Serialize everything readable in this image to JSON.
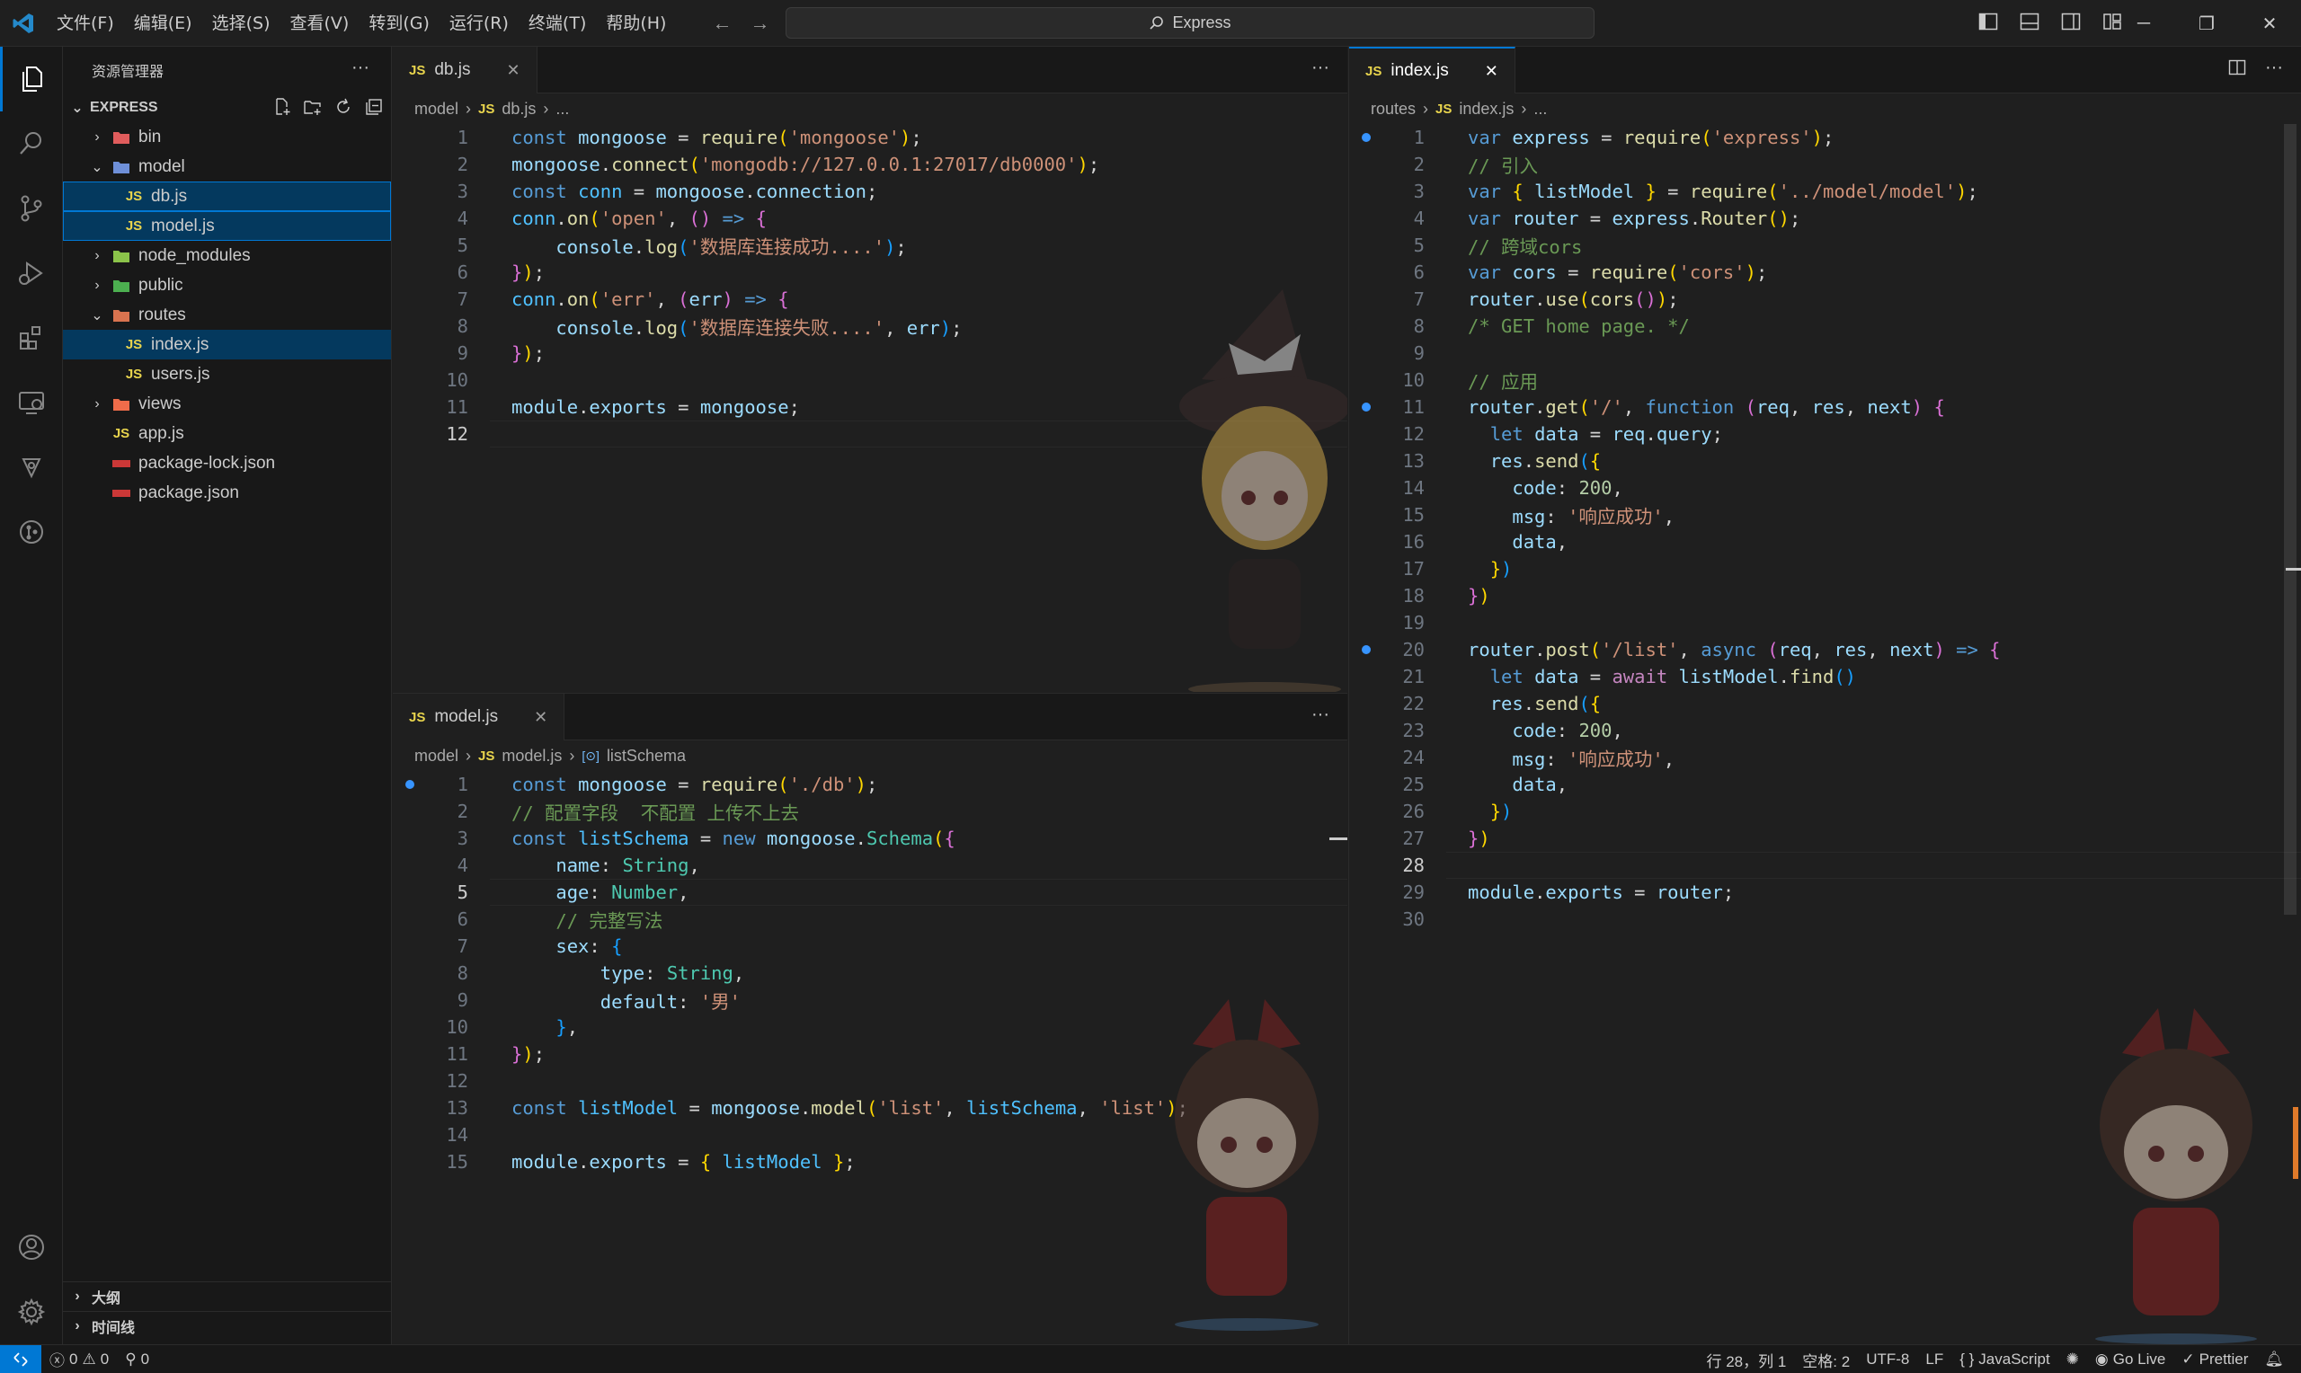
{
  "titlebar": {
    "menu": [
      "文件(F)",
      "编辑(E)",
      "选择(S)",
      "查看(V)",
      "转到(G)",
      "运行(R)",
      "终端(T)",
      "帮助(H)"
    ],
    "search_text": "Express"
  },
  "sidebar": {
    "title": "资源管理器",
    "root": "EXPRESS",
    "tree": [
      {
        "label": "bin"
      },
      {
        "label": "model"
      },
      {
        "label": "db.js"
      },
      {
        "label": "model.js"
      },
      {
        "label": "node_modules"
      },
      {
        "label": "public"
      },
      {
        "label": "routes"
      },
      {
        "label": "index.js"
      },
      {
        "label": "users.js"
      },
      {
        "label": "views"
      },
      {
        "label": "app.js"
      },
      {
        "label": "package-lock.json"
      },
      {
        "label": "package.json"
      }
    ],
    "outline": "大纲",
    "timeline": "时间线"
  },
  "editor_top": {
    "tab": "db.js",
    "badge": "JS",
    "breadcrumb": [
      "model",
      "db.js",
      "..."
    ]
  },
  "editor_bottom": {
    "tab": "model.js",
    "badge": "JS",
    "breadcrumb": [
      "model",
      "model.js",
      "listSchema"
    ]
  },
  "editor_right": {
    "tab": "index.js",
    "badge": "JS",
    "breadcrumb": [
      "routes",
      "index.js",
      "..."
    ]
  },
  "statusbar": {
    "errors": "0",
    "warnings": "0",
    "ports": "0",
    "position": "行 28，列 1",
    "indent": "空格: 2",
    "encoding": "UTF-8",
    "eol": "LF",
    "language": "JavaScript",
    "golive": "Go Live",
    "prettier": "Prettier"
  },
  "colors": {
    "accent": "#0078d4",
    "js_badge": "#e8d44d"
  }
}
